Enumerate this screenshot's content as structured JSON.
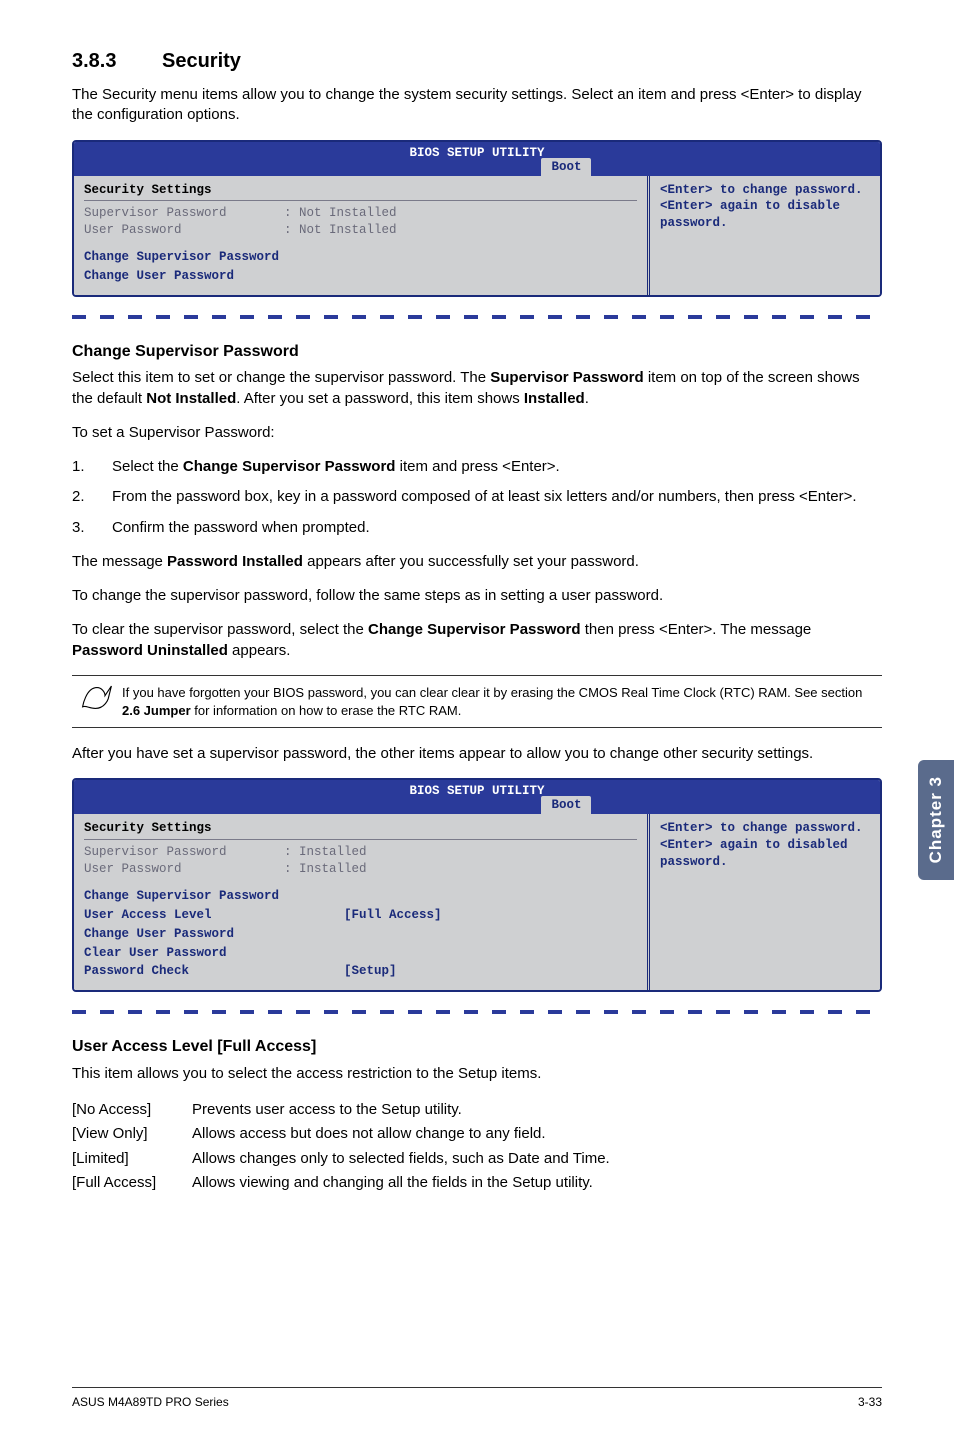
{
  "side_tab": "Chapter 3",
  "section": {
    "number": "3.8.3",
    "title": "Security"
  },
  "intro": "The Security menu items allow you to change the system security settings. Select an item and press <Enter> to display the configuration options.",
  "bios1": {
    "title": "BIOS SETUP UTILITY",
    "tab": "Boot",
    "heading": "Security Settings",
    "rows": [
      {
        "label": "Supervisor Password",
        "value": ": Not Installed"
      },
      {
        "label": "User Password",
        "value": ": Not Installed"
      }
    ],
    "links": [
      "Change Supervisor Password",
      "Change User Password"
    ],
    "help": "<Enter> to change password.\n<Enter> again to disable password."
  },
  "csp_heading": "Change Supervisor Password",
  "csp_p1": "Select this item to set or change the supervisor password. The Supervisor Password item on top of the screen shows the default Not Installed. After you set a password, this item shows Installed.",
  "csp_p1_bold": {
    "b1": "Supervisor Password",
    "b2": "Not Installed",
    "b3": "Installed"
  },
  "csp_p2": "To set a Supervisor Password:",
  "steps": [
    {
      "n": "1.",
      "text_pre": "Select the ",
      "bold": "Change Supervisor Password",
      "text_post": " item and press <Enter>."
    },
    {
      "n": "2.",
      "text_pre": "From the password box, key in a password composed of at least six letters and/or numbers, then press <Enter>.",
      "bold": "",
      "text_post": ""
    },
    {
      "n": "3.",
      "text_pre": "Confirm the password when prompted.",
      "bold": "",
      "text_post": ""
    }
  ],
  "msg1_pre": "The message ",
  "msg1_bold": "Password Installed",
  "msg1_post": " appears after you successfully set your password.",
  "msg2": "To change the supervisor password, follow the same steps as in setting a user password.",
  "msg3_pre": "To clear the supervisor password, select the ",
  "msg3_bold1": "Change Supervisor Password",
  "msg3_mid": " then press <Enter>. The message ",
  "msg3_bold2": "Password Uninstalled",
  "msg3_post": " appears.",
  "note": "If you have forgotten your BIOS password, you can clear clear it by erasing the CMOS Real Time Clock (RTC) RAM. See section 2.6 Jumper for information on how to erase the RTC RAM.",
  "note_bold": "2.6 Jumper",
  "after_note": "After you have set a supervisor password, the other items appear to allow you to change other security settings.",
  "bios2": {
    "title": "BIOS SETUP UTILITY",
    "tab": "Boot",
    "heading": "Security Settings",
    "rows": [
      {
        "label": "Supervisor Password",
        "value": ": Installed"
      },
      {
        "label": "User Password",
        "value": ": Installed"
      }
    ],
    "links": [
      {
        "text": "Change Supervisor Password",
        "opt": ""
      },
      {
        "text": "User Access Level",
        "opt": "[Full Access]"
      },
      {
        "text": "Change User Password",
        "opt": ""
      },
      {
        "text": "Clear User Password",
        "opt": ""
      },
      {
        "text": "Password Check",
        "opt": "[Setup]"
      }
    ],
    "help": "<Enter> to change password.\n<Enter> again to disabled password."
  },
  "ual_heading": "User Access Level [Full Access]",
  "ual_intro": "This item allows you to select the access restriction to the Setup items.",
  "opts": [
    {
      "k": "[No Access]",
      "v": "Prevents user access to the Setup utility."
    },
    {
      "k": "[View Only]",
      "v": "Allows access but does not allow change to any field."
    },
    {
      "k": "[Limited]",
      "v": "Allows changes only to selected fields, such as Date and Time."
    },
    {
      "k": "[Full Access]",
      "v": "Allows viewing and changing all the fields in the Setup utility."
    }
  ],
  "footer_left": "ASUS M4A89TD PRO Series",
  "footer_right": "3-33"
}
